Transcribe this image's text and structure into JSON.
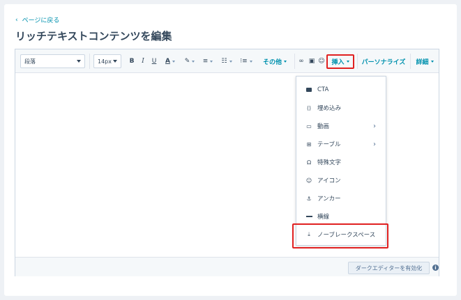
{
  "header": {
    "back_label": "ページに戻る",
    "title": "リッチテキストコンテンツを編集"
  },
  "toolbar": {
    "paragraph_select": "段落",
    "font_size_select": "14px",
    "bold": "B",
    "italic": "I",
    "underline": "U",
    "text_color": "A",
    "more_label": "その他",
    "insert_label": "挿入",
    "personalize_label": "パーソナライズ",
    "advanced_label": "詳細"
  },
  "insert_menu": {
    "items": [
      {
        "label": "CTA",
        "icon": "cta-icon"
      },
      {
        "label": "埋め込み",
        "icon": "embed-code-icon"
      },
      {
        "label": "動画",
        "icon": "video-icon",
        "submenu": true
      },
      {
        "label": "テーブル",
        "icon": "table-icon",
        "submenu": true
      },
      {
        "label": "特殊文字",
        "icon": "omega-icon"
      },
      {
        "label": "アイコン",
        "icon": "emoji-icon"
      },
      {
        "label": "アンカー",
        "icon": "anchor-icon"
      },
      {
        "label": "横線",
        "icon": "horizontal-line-icon"
      },
      {
        "label": "ノーブレークスペース",
        "icon": "nbsp-icon"
      }
    ]
  },
  "footer": {
    "dark_editor_button": "ダークエディターを有効化",
    "info_symbol": "i"
  },
  "colors": {
    "accent": "#0091ae",
    "highlight": "#e02020",
    "text": "#33475b"
  }
}
